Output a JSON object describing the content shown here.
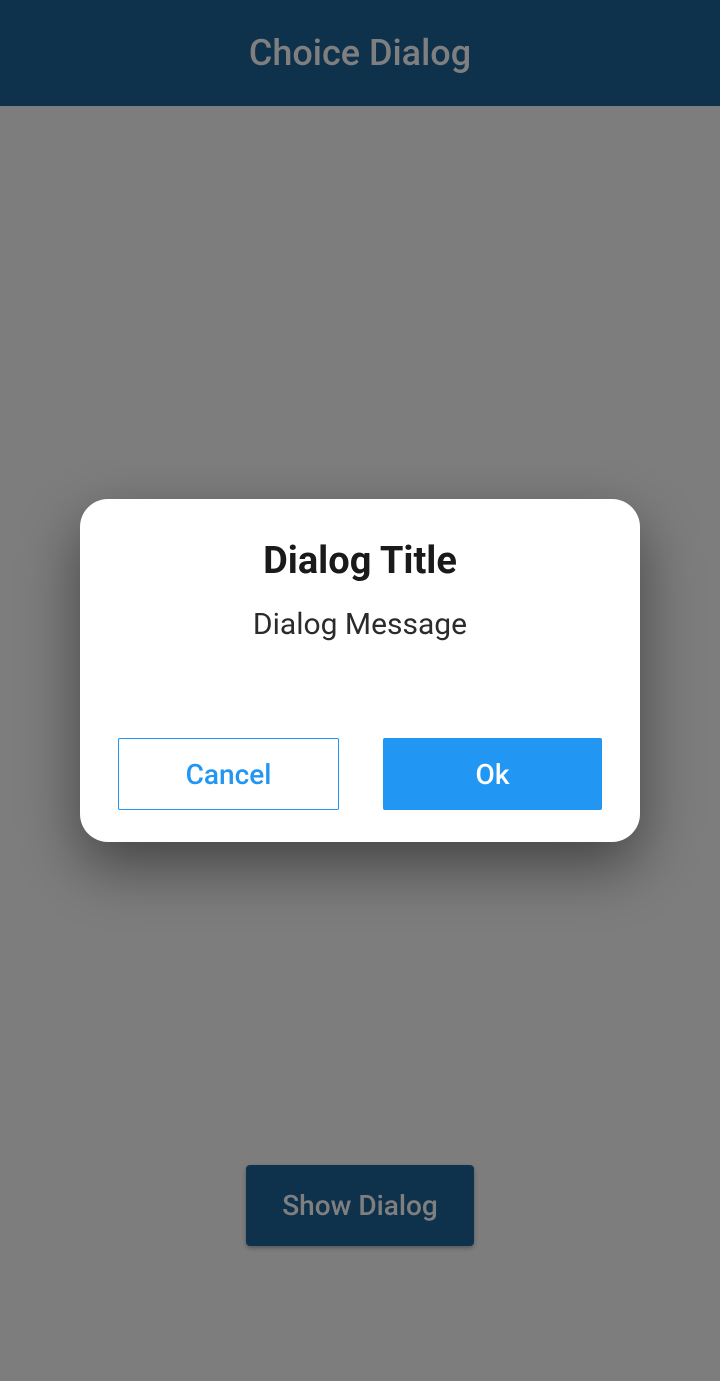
{
  "app_bar": {
    "title": "Choice Dialog"
  },
  "main": {
    "show_dialog_label": "Show Dialog"
  },
  "dialog": {
    "title": "Dialog Title",
    "message": "Dialog Message",
    "cancel_label": "Cancel",
    "ok_label": "Ok"
  },
  "colors": {
    "primary": "#1c6399",
    "accent": "#2196f3"
  }
}
